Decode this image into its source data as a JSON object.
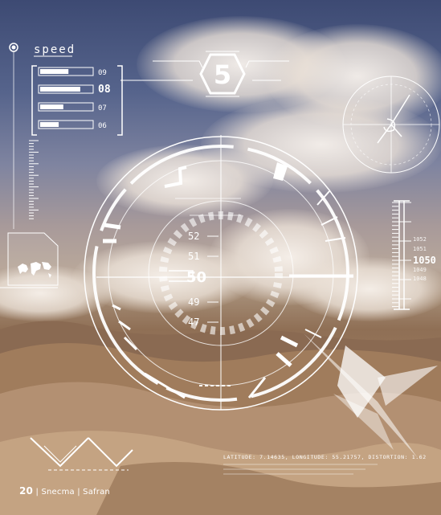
{
  "hud": {
    "speed_label": "speed",
    "gear_number": "5",
    "speed_bars": [
      {
        "value": "09",
        "fill": 0.55,
        "highlighted": false
      },
      {
        "value": "08",
        "fill": 0.78,
        "highlighted": true
      },
      {
        "value": "07",
        "fill": 0.45,
        "highlighted": false
      },
      {
        "value": "06",
        "fill": 0.36,
        "highlighted": false
      }
    ],
    "pitch_scale": [
      "52",
      "51",
      "50",
      "49",
      "47"
    ],
    "pitch_current": "50",
    "altitude_scale": [
      "1052",
      "1051",
      "1050",
      "1049",
      "1048"
    ],
    "altitude_current": "1050",
    "coordinates": "LATITUDE: 7.14635, LONGITUDE: 55.21757, DISTORTION: 1.62"
  },
  "caption": {
    "page_number": "20",
    "publication": "Snecma",
    "publisher": "Safran"
  },
  "colors": {
    "hud_white": "#ffffff",
    "sky_top": "#3d4a73",
    "desert": "#b59676"
  }
}
